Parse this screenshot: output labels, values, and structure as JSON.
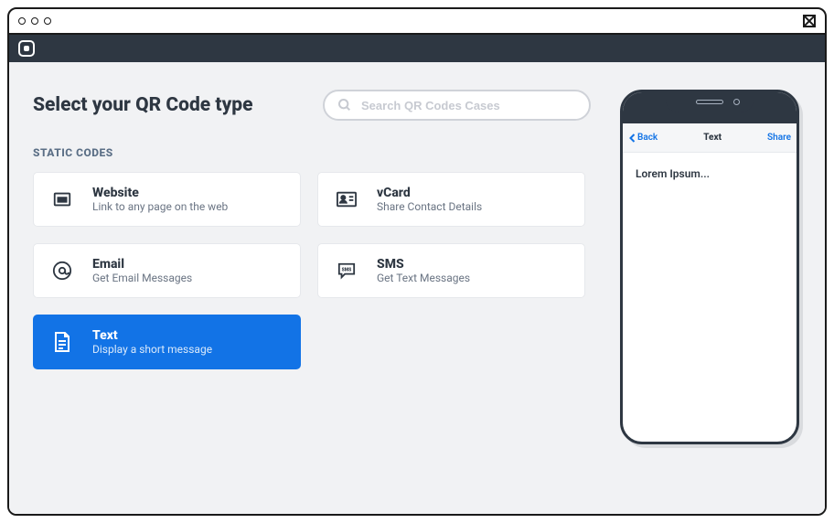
{
  "page_title": "Select your QR Code type",
  "search": {
    "placeholder": "Search QR Codes Cases"
  },
  "section_label": "STATIC CODES",
  "cards": [
    {
      "title": "Website",
      "subtitle": "Link to any page on the web"
    },
    {
      "title": "vCard",
      "subtitle": "Share Contact Details"
    },
    {
      "title": "Email",
      "subtitle": "Get Email Messages"
    },
    {
      "title": "SMS",
      "subtitle": "Get Text Messages"
    },
    {
      "title": "Text",
      "subtitle": "Display a short message"
    }
  ],
  "selected_index": 4,
  "preview": {
    "back_label": "Back",
    "title": "Text",
    "share_label": "Share",
    "body": "Lorem Ipsum..."
  }
}
